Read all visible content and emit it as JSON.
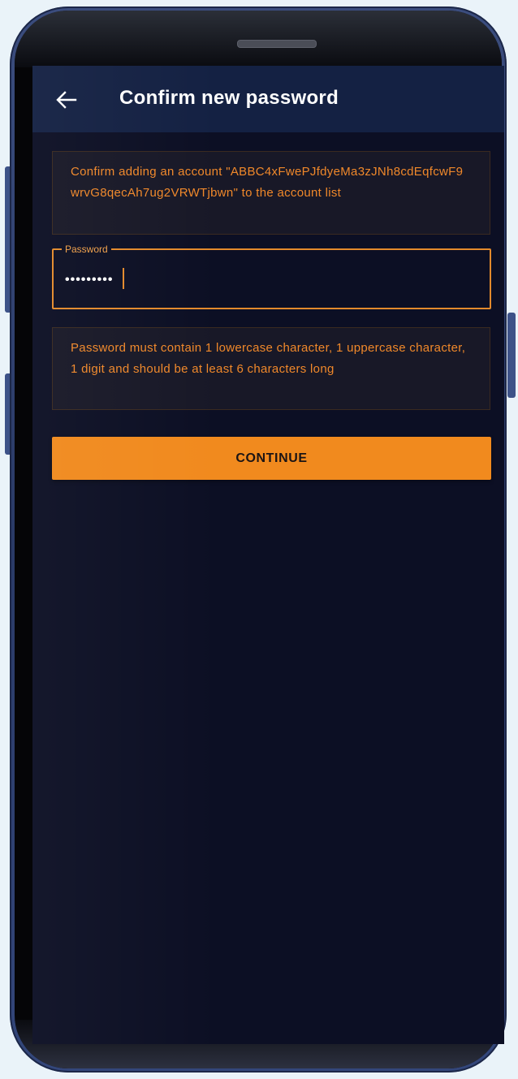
{
  "colors": {
    "accent": "#f18a1e",
    "appbar": "#142143",
    "screen_bg": "#0c0f24",
    "info_text": "#f0882a"
  },
  "header": {
    "back_icon": "arrow-left-icon",
    "title": "Confirm new password"
  },
  "account_notice": {
    "text": "Confirm adding an account \"ABBC4xFwePJfdyeMa3zJNh8cdEqfcwF9wrvG8qecAh7ug2VRWTjbwn\" to the account list"
  },
  "password_field": {
    "label": "Password",
    "value": "•••••••••"
  },
  "password_rules": {
    "text": "Password must contain 1 lowercase character, 1 uppercase character, 1 digit and should be at least 6 characters long"
  },
  "actions": {
    "continue_label": "CONTINUE"
  }
}
